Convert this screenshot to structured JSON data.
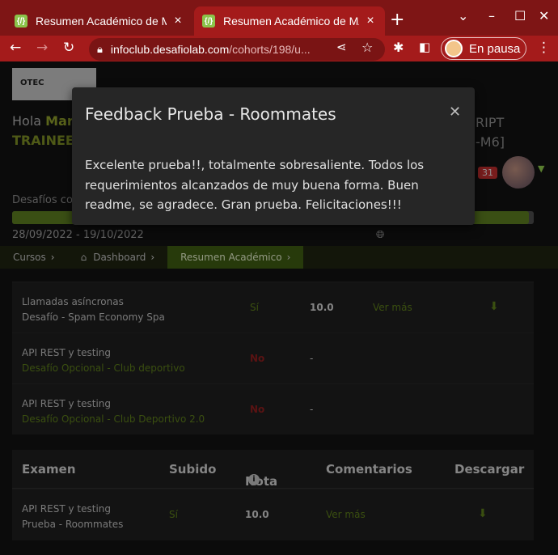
{
  "browser": {
    "tabs": [
      {
        "title": "Resumen Académico de MAF",
        "favicon": "{/}"
      },
      {
        "title": "Resumen Académico de MAF",
        "favicon": "{/}"
      }
    ],
    "url_host": "infoclub.desafiolab.com",
    "url_path": "/cohorts/198/u...",
    "profile_label": "En pausa",
    "accent": "#a41b1b"
  },
  "header": {
    "logo_text": "OTEC",
    "greeting": "Hola",
    "name": "María",
    "trainee": "TRAINEE -",
    "right_line1": "RIPT",
    "right_line2": "-M6]",
    "notif_count": "31",
    "desafios_label": "Desafíos com",
    "progress_fraction": 0.99,
    "dates": "28/09/2022 - 19/10/2022"
  },
  "breadcrumb": {
    "items": [
      "Cursos",
      "Dashboard",
      "Resumen Académico"
    ]
  },
  "challenges": [
    {
      "title": "Llamadas asíncronas",
      "subtitle": "Desafío - Spam Economy Spa",
      "subtitle_style": "plain",
      "subido": "Sí",
      "nota": "10.0",
      "comentarios": "Ver más",
      "download": true
    },
    {
      "title": "API REST y testing",
      "subtitle": "Desafío Opcional - Club deportivo",
      "subtitle_style": "link",
      "subido": "No",
      "nota": "-",
      "comentarios": "",
      "download": false
    },
    {
      "title": "API REST y testing",
      "subtitle": "Desafío Opcional - Club Deportivo 2.0",
      "subtitle_style": "link",
      "subido": "No",
      "nota": "-",
      "comentarios": "",
      "download": false
    }
  ],
  "exam": {
    "headers": {
      "examen": "Examen",
      "subido": "Subido",
      "nota": "Nota",
      "comentarios": "Comentarios",
      "descargar": "Descargar"
    },
    "row": {
      "title": "API REST y testing",
      "subtitle": "Prueba - Roommates",
      "subido": "Sí",
      "nota": "10.0",
      "comentarios": "Ver más"
    }
  },
  "modal": {
    "title": "Feedback Prueba - Roommates",
    "body": "Excelente prueba!!, totalmente sobresaliente. Todos los requerimientos alcanzados de muy buena forma. Buen readme, se agradece. Gran prueba. Felicitaciones!!!"
  }
}
